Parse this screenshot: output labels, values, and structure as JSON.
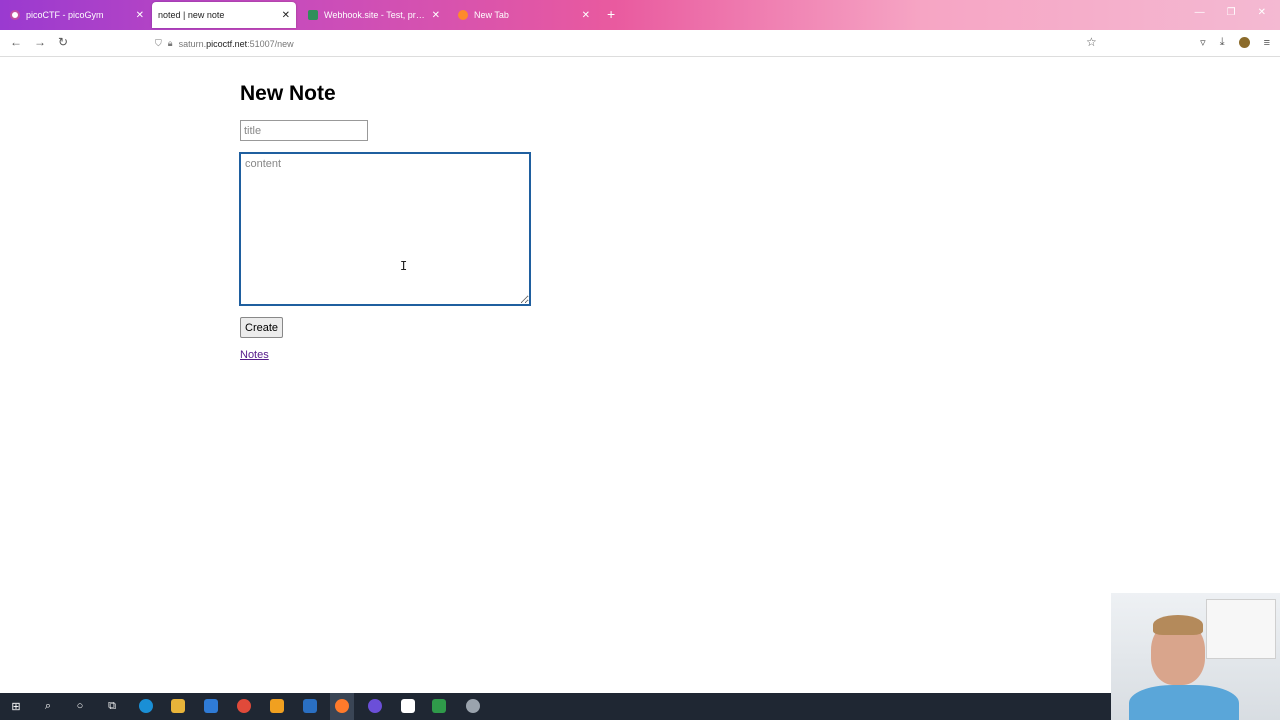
{
  "browser": {
    "tabs": [
      {
        "label": "picoCTF - picoGym",
        "active": false
      },
      {
        "label": "noted | new note",
        "active": true
      },
      {
        "label": "Webhook.site - Test, process an",
        "active": false
      },
      {
        "label": "New Tab",
        "active": false
      }
    ],
    "new_tab": "+",
    "url_host": "saturn.",
    "url_domain": "picoctf.net",
    "url_path": ":51007/new"
  },
  "page": {
    "title": "New Note",
    "title_placeholder": "title",
    "content_placeholder": "content",
    "create_label": "Create",
    "notes_link": "Notes"
  }
}
